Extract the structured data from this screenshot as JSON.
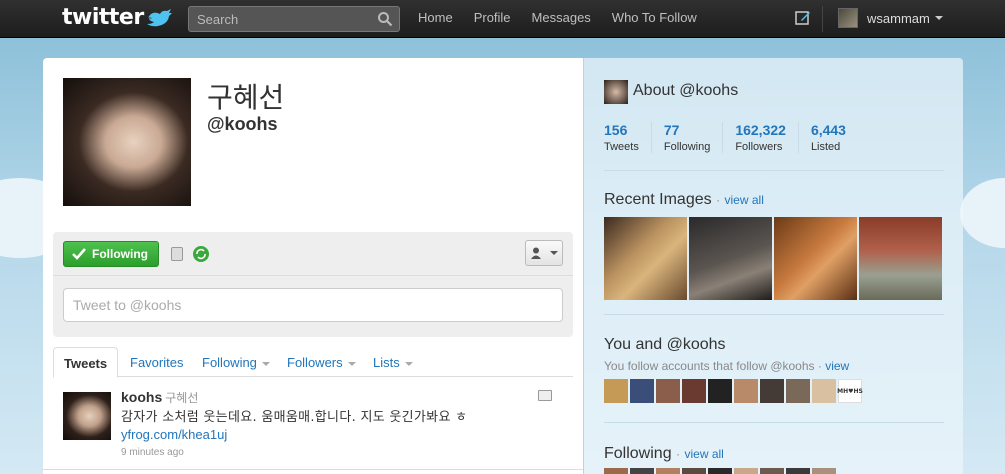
{
  "topbar": {
    "logo": "twitter",
    "search_placeholder": "Search",
    "nav": [
      "Home",
      "Profile",
      "Messages",
      "Who To Follow"
    ],
    "username": "wsammam"
  },
  "profile": {
    "name": "구혜선",
    "handle": "@koohs",
    "follow_button": "Following",
    "tweet_box_placeholder": "Tweet to @koohs"
  },
  "tabs": {
    "tweets": "Tweets",
    "favorites": "Favorites",
    "following": "Following",
    "followers": "Followers",
    "lists": "Lists"
  },
  "tweet": {
    "username": "koohs",
    "fullname": "구혜선",
    "text": "감자가 소처럼 웃는데요. 움매움매.합니다. 지도 웃긴가봐요 ㅎ",
    "link": "yfrog.com/khea1uj",
    "time": "9 minutes ago"
  },
  "sidebar": {
    "about_title": "About @koohs",
    "stats": {
      "tweets_num": "156",
      "tweets_label": "Tweets",
      "following_num": "77",
      "following_label": "Following",
      "followers_num": "162,322",
      "followers_label": "Followers",
      "listed_num": "6,443",
      "listed_label": "Listed"
    },
    "recent_images_title": "Recent Images",
    "view_all": "view all",
    "you_and_title": "You and @koohs",
    "you_follow_text": "You follow accounts that follow @koohs ·",
    "view_link": "view",
    "following_title": "Following",
    "face_label": "MH♥HS"
  },
  "colors": {
    "link": "#2276bb",
    "follow_green": "#2c9e2c",
    "topbar": "#1d1d1d",
    "background": "#c0deed"
  }
}
